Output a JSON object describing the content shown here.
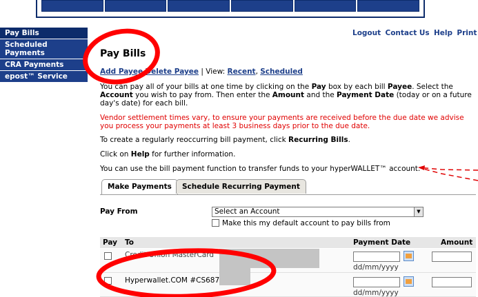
{
  "header": {
    "links": [
      "Logout",
      "Contact Us",
      "Help",
      "Print"
    ]
  },
  "sidebar": {
    "items": [
      {
        "label": "Pay Bills"
      },
      {
        "label": "Scheduled Payments"
      },
      {
        "label": "CRA Payments"
      },
      {
        "label": "epost™ Service"
      }
    ]
  },
  "main": {
    "title": "Pay Bills",
    "links": {
      "add_payee": "Add Payee",
      "delete_payee": "Delete Payee",
      "separator": "|",
      "view_label": "View:",
      "recent": "Recent",
      "scheduled": "Scheduled"
    },
    "p1": {
      "t1": "You can pay all of your bills at one time by clicking on the ",
      "b1": "Pay",
      "t2": " box by each bill ",
      "b2": "Payee",
      "t3": ". Select the ",
      "b3": "Account",
      "t4": " you wish to pay from. Then enter the ",
      "b4": "Amount",
      "t5": " and the ",
      "b5": "Payment Date",
      "t6": " (today or on a future day's date) for each bill."
    },
    "p2": "Vendor settlement times vary, to ensure your payments are received before the due date we advise you process your payments at least 3 business days prior to the due date.",
    "p3": {
      "t1": "To create a regularly reoccurring bill payment, click ",
      "b1": "Recurring Bills",
      "t2": "."
    },
    "p4": {
      "t1": "Click on ",
      "b1": "Help",
      "t2": " for further information."
    },
    "p5": "You can use the bill payment function to transfer funds to your hyperWALLET™ account.",
    "tabs": [
      "Make Payments",
      "Schedule Recurring Payment"
    ],
    "pay_from": {
      "label": "Pay From",
      "selected": "Select an Account",
      "default_label": "Make this my default account to pay bills from"
    },
    "table": {
      "headers": {
        "pay": "Pay",
        "to": "To",
        "payment_date": "Payment Date",
        "amount": "Amount"
      },
      "rows": [
        {
          "payee": "Credit Union MasterCard",
          "date_hint": "dd/mm/yyyy"
        },
        {
          "payee": "Hyperwallet.COM   #CS687",
          "date_hint": "dd/mm/yyyy"
        }
      ]
    }
  },
  "colors": {
    "nav_blue": "#1d3f8a",
    "nav_dark": "#0d2c6b",
    "warning_red": "#e00000",
    "annotation_red": "#ff0000"
  }
}
